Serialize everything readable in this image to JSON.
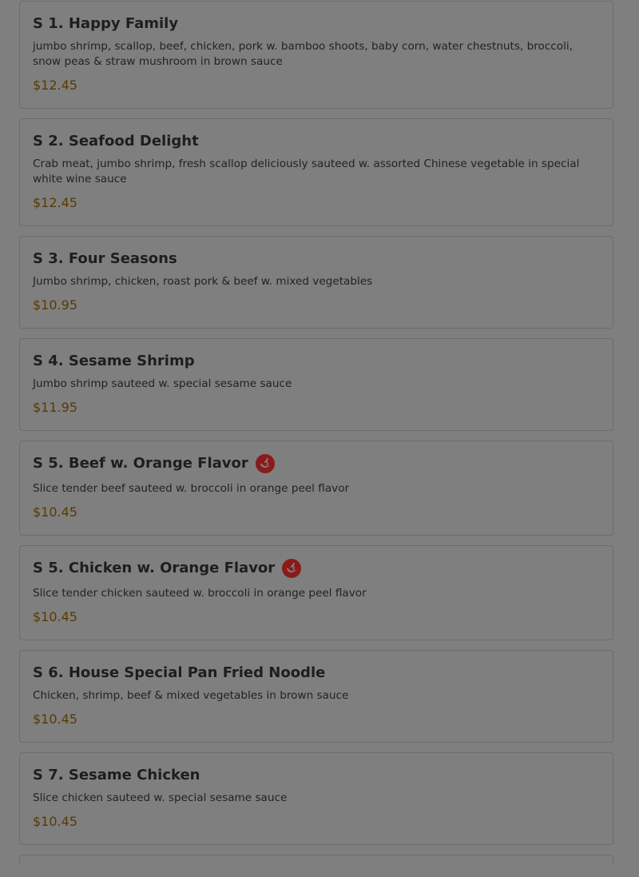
{
  "menu": {
    "items": [
      {
        "title": "S 1. Happy Family",
        "description": "jumbo shrimp, scallop, beef, chicken, pork w. bamboo shoots, baby corn, water chestnuts, broccoli, snow peas & straw mushroom in brown sauce",
        "price": "$12.45",
        "spicy": false
      },
      {
        "title": "S 2. Seafood Delight",
        "description": "Crab meat, jumbo shrimp, fresh scallop deliciously sauteed w. assorted Chinese vegetable in special white wine sauce",
        "price": "$12.45",
        "spicy": false
      },
      {
        "title": "S 3. Four Seasons",
        "description": "Jumbo shrimp, chicken, roast pork & beef w. mixed vegetables",
        "price": "$10.95",
        "spicy": false
      },
      {
        "title": "S 4. Sesame Shrimp",
        "description": "Jumbo shrimp sauteed w. special sesame sauce",
        "price": "$11.95",
        "spicy": false
      },
      {
        "title": "S 5. Beef w. Orange Flavor",
        "description": "Slice tender beef sauteed w. broccoli in orange peel flavor",
        "price": "$10.45",
        "spicy": true
      },
      {
        "title": "S 5. Chicken w. Orange Flavor",
        "description": "Slice tender chicken sauteed w. broccoli in orange peel flavor",
        "price": "$10.45",
        "spicy": true
      },
      {
        "title": "S 6. House Special Pan Fried Noodle",
        "description": "Chicken, shrimp, beef & mixed vegetables in brown sauce",
        "price": "$10.45",
        "spicy": false
      },
      {
        "title": "S 7. Sesame Chicken",
        "description": "Slice chicken sauteed w. special sesame sauce",
        "price": "$10.45",
        "spicy": false
      }
    ]
  },
  "colors": {
    "overlay_background": "#7f7f7f",
    "price": "#5a3a00",
    "spicy_icon": "#8b1a1a"
  },
  "icons": {
    "spicy": "chili-pepper-icon"
  }
}
